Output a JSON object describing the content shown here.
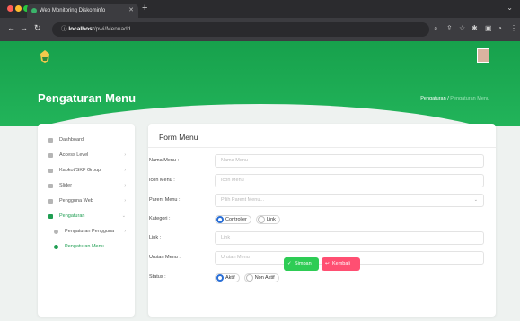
{
  "browser": {
    "tab_title": "Web Monitoring Diskominfo",
    "url_host": "localhost",
    "url_path": "/pwi/Menuadd",
    "chrome_icons": [
      "back-icon",
      "forward-icon",
      "reload-icon",
      "info-icon",
      "search-icon",
      "share-icon",
      "star-icon",
      "extension-icon",
      "sidebar-icon",
      "more-icon"
    ]
  },
  "header": {
    "page_title": "Pengaturan Menu",
    "breadcrumb_parent": "Pengaturan",
    "breadcrumb_separator": "/",
    "breadcrumb_current": "Pengaturan Menu",
    "hero_color": "#1fa954"
  },
  "sidebar": {
    "items": [
      {
        "label": "Dashboard",
        "has_chevron": false
      },
      {
        "label": "Access Level",
        "has_chevron": true
      },
      {
        "label": "Kabkot/SKF Group",
        "has_chevron": true
      },
      {
        "label": "Slider",
        "has_chevron": true
      },
      {
        "label": "Pengguna Web",
        "has_chevron": true
      },
      {
        "label": "Pengaturan",
        "has_chevron": true,
        "active": true
      },
      {
        "label": "Pengaturan Pengguna",
        "has_chevron": true
      },
      {
        "label": "Pengaturan Menu",
        "active": true,
        "sub": true
      }
    ]
  },
  "form": {
    "title": "Form Menu",
    "nama_menu": {
      "label": "Nama Menu :",
      "placeholder": "Nama Menu"
    },
    "icon_menu": {
      "label": "Icon Menu :",
      "placeholder": "Icon Menu"
    },
    "parent_menu": {
      "label": "Parent Menu :",
      "selected": "Pilih Parent Menu..."
    },
    "kategori": {
      "label": "Kategori :",
      "options": [
        "Controller",
        "Link"
      ],
      "selected": "Controller"
    },
    "link": {
      "label": "Link :",
      "placeholder": "Link"
    },
    "urutan_menu": {
      "label": "Urutan Menu :",
      "placeholder": "Urutan Menu"
    },
    "status": {
      "label": "Status :",
      "options": [
        "Aktif",
        "Non Aktif"
      ],
      "selected": "Aktif"
    },
    "save_label": "Simpan",
    "back_label": "Kembali",
    "save_color": "#2ecc55",
    "back_color": "#ff4f72"
  }
}
